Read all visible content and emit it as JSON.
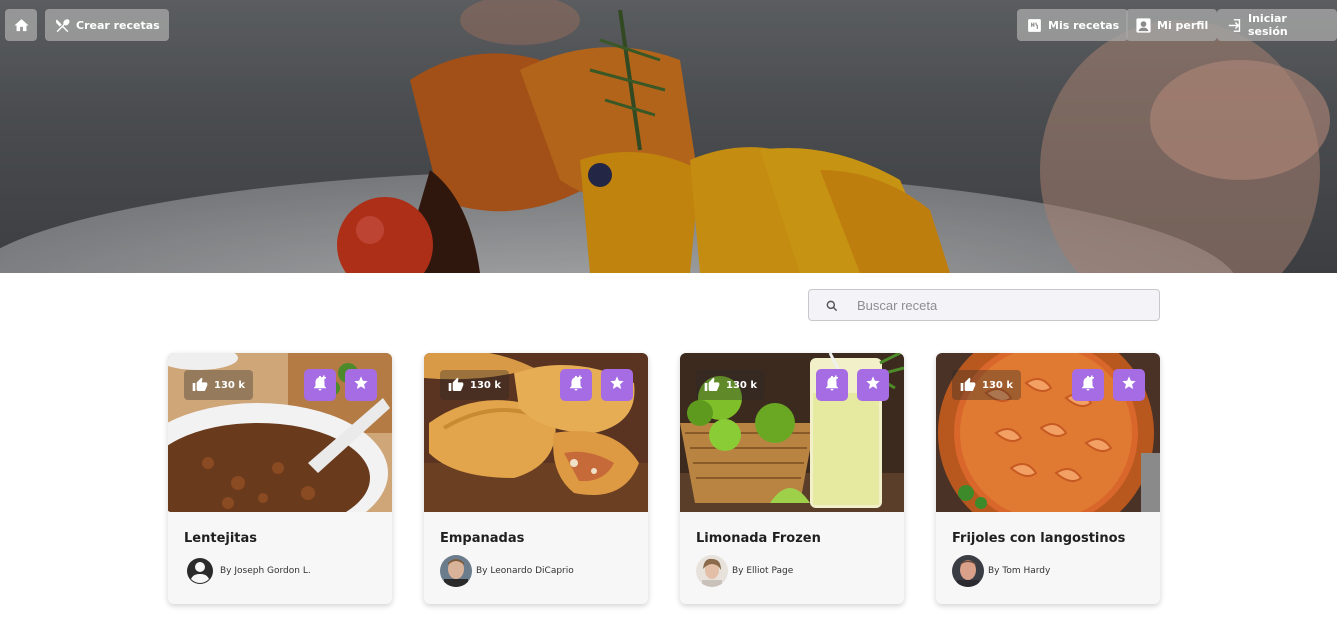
{
  "nav": {
    "crear_label": "Crear recetas",
    "mis_label": "Mis recetas",
    "perfil_label": "Mi perfil",
    "login_label": "Iniciar sesión"
  },
  "search": {
    "placeholder": "Buscar receta"
  },
  "accent_color": "#a66ce4",
  "recipes": [
    {
      "title": "Lentejitas",
      "likes": "130 k",
      "author": "By Joseph Gordon L.",
      "avatar": "generic-user-icon"
    },
    {
      "title": "Empanadas",
      "likes": "130 k",
      "author": "By Leonardo DiCaprio",
      "avatar": "photo"
    },
    {
      "title": "Limonada Frozen",
      "likes": "130 k",
      "author": "By Elliot Page",
      "avatar": "photo"
    },
    {
      "title": "Frijoles con langostinos",
      "likes": "130 k",
      "author": "By Tom Hardy",
      "avatar": "photo"
    }
  ]
}
